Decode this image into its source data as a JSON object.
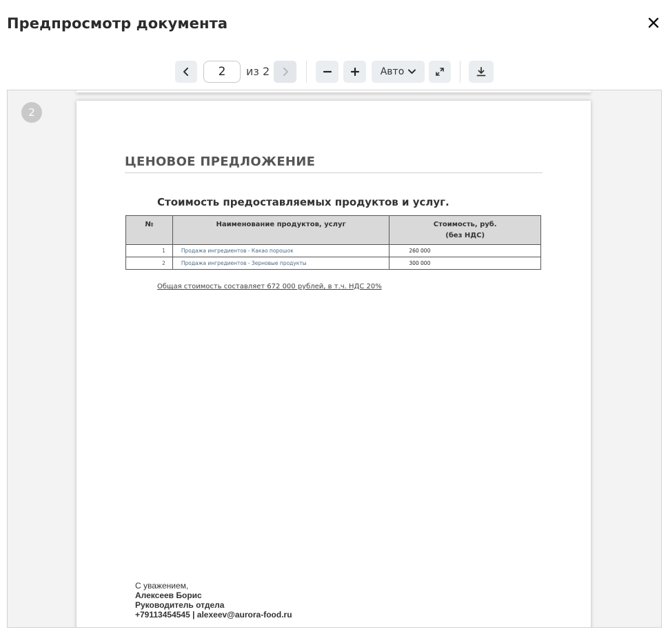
{
  "modal": {
    "title": "Предпросмотр документа"
  },
  "toolbar": {
    "current_page": "2",
    "page_of": "из 2",
    "zoom_label": "Авто",
    "icons": {
      "prev": "chevron-left-icon",
      "next": "chevron-right-icon",
      "zoom_out": "minus-icon",
      "zoom_in": "plus-icon",
      "dropdown": "chevron-down-icon",
      "fullscreen": "expand-icon",
      "download": "download-icon",
      "close": "close-icon"
    }
  },
  "viewer": {
    "page_number_badge": "2"
  },
  "document": {
    "heading": "ЦЕНОВОЕ ПРЕДЛОЖЕНИЕ",
    "subheading": "Стоимость предоставляемых продуктов и услуг.",
    "table": {
      "columns": [
        "№",
        "Наименование продуктов, услуг",
        "Стоимость, руб.",
        "(без НДС)"
      ],
      "rows": [
        {
          "num": "1",
          "name": "Продажа ингредиентов - Какао порошок",
          "cost": "260 000"
        },
        {
          "num": "2",
          "name": "Продажа ингредиентов - Зерновые продукты",
          "cost": "300 000"
        }
      ]
    },
    "total": "Общая стоимость составляет 672 000 рублей, в т.ч. НДС 20%",
    "signature": {
      "greeting": "С уважением,",
      "name": "Алексеев Борис",
      "position": "Руководитель отдела",
      "contact": "+79113454545 | alexeev@aurora-food.ru"
    }
  }
}
